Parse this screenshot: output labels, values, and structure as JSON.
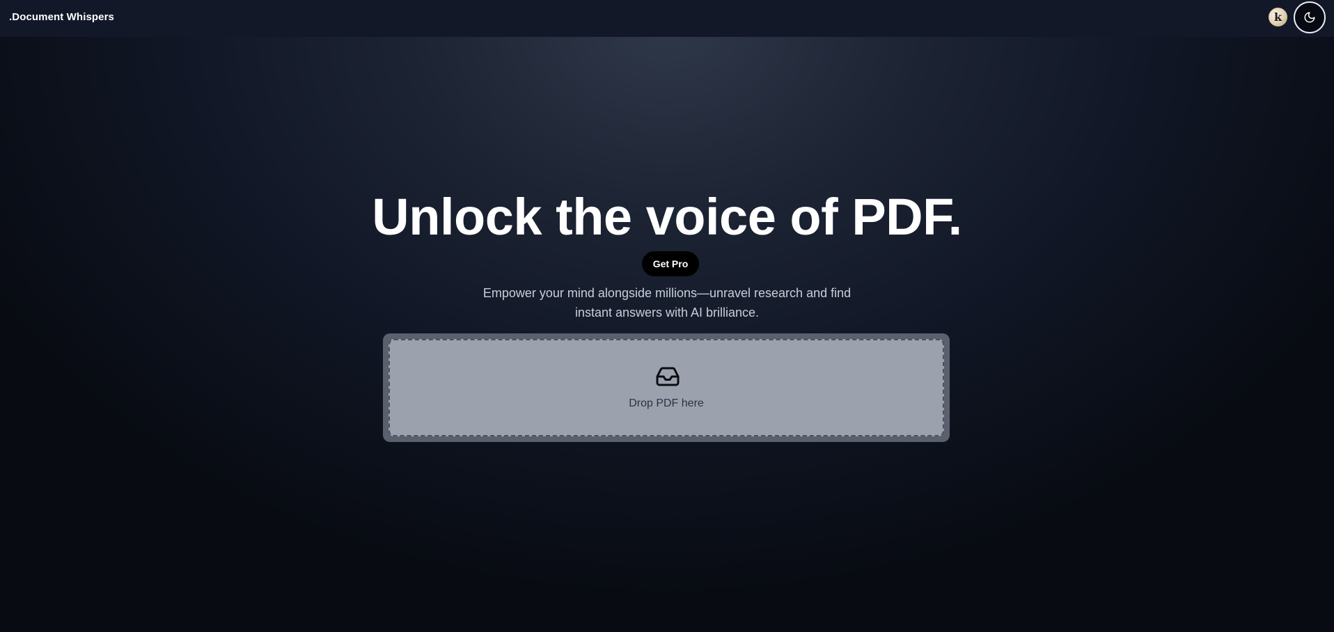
{
  "header": {
    "brand": ".Document Whispers",
    "avatar_letter": "k",
    "theme_toggle_icon": "moon-icon"
  },
  "hero": {
    "title": "Unlock the voice of PDF.",
    "pro_button_label": "Get Pro",
    "subtitle_line1": "Empower your mind alongside millions—unravel research and find",
    "subtitle_line2": "instant answers with AI brilliance."
  },
  "dropzone": {
    "icon": "inbox-icon",
    "label": "Drop PDF here"
  },
  "colors": {
    "background_top": "#2f3849",
    "background_bottom": "#080b12",
    "topbar": "#121828",
    "dropzone_frame": "#5a606d",
    "dropzone_fill": "#9ca2ad",
    "pro_button": "#000000"
  }
}
